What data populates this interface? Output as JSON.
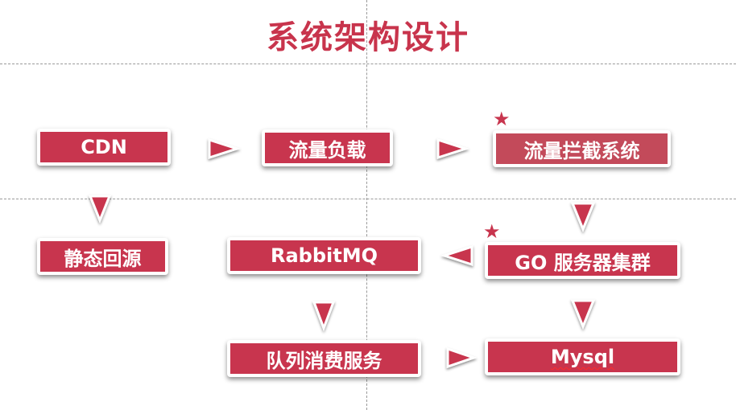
{
  "title": "系统架构设计",
  "nodes": {
    "cdn": "CDN",
    "traffic_lb": "流量负载",
    "traffic_block": "流量拦截系统",
    "static_origin": "静态回源",
    "rabbitmq": "RabbitMQ",
    "go_cluster": "GO 服务器集群",
    "queue_service": "队列消费服务",
    "mysql": "Mysql"
  },
  "markers": {
    "star": "★"
  },
  "colors": {
    "accent": "#c8354e",
    "title": "#c8344c",
    "guide": "#9a9a9a"
  }
}
